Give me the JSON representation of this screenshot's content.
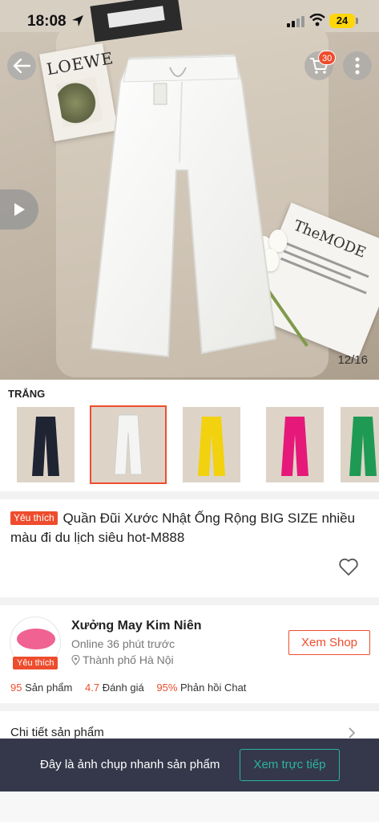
{
  "status_bar": {
    "time": "18:08",
    "battery": "24"
  },
  "header": {
    "cart_count": "30"
  },
  "gallery": {
    "counter": "12/16",
    "hero_magazine_left": "LOEWE",
    "hero_magazine_right": "TheMODE"
  },
  "variations": {
    "selected_label": "TRẮNG",
    "items": [
      {
        "name": "black",
        "color": "#1f2433"
      },
      {
        "name": "white",
        "color": "#f4f4f2"
      },
      {
        "name": "yellow",
        "color": "#f2d10f"
      },
      {
        "name": "pink",
        "color": "#e6197a"
      },
      {
        "name": "green",
        "color": "#1f9a54"
      }
    ],
    "selected_index": 1
  },
  "product": {
    "favorite_tag": "Yêu thích",
    "title": "Quần Đũi Xước Nhật Ống Rộng BIG SIZE nhiều màu đi du lịch siêu hot-M888"
  },
  "shop": {
    "name": "Xưởng May Kim Niên",
    "online": "Online 36 phút trước",
    "location": "Thành phố Hà Nội",
    "favorite_tag": "Yêu thích",
    "button": "Xem Shop",
    "stats": [
      {
        "num": "95",
        "label": "Sản phẩm"
      },
      {
        "num": "4.7",
        "label": "Đánh giá"
      },
      {
        "num": "95%",
        "label": "Phản hồi Chat"
      }
    ]
  },
  "details": {
    "title": "Chi tiết sản phẩm"
  },
  "snapshot": {
    "text": "Đây là ảnh chụp nhanh sản phẩm",
    "button": "Xem trực tiếp"
  },
  "colors": {
    "accent": "#ee4d2d",
    "teal": "#2bb3a3",
    "banner": "#35384a"
  },
  "icons": [
    "location-arrow-icon",
    "signal-icon",
    "wifi-icon",
    "back-arrow-icon",
    "cart-icon",
    "more-icon",
    "play-icon",
    "heart-icon",
    "pin-icon",
    "chevron-right-icon"
  ]
}
